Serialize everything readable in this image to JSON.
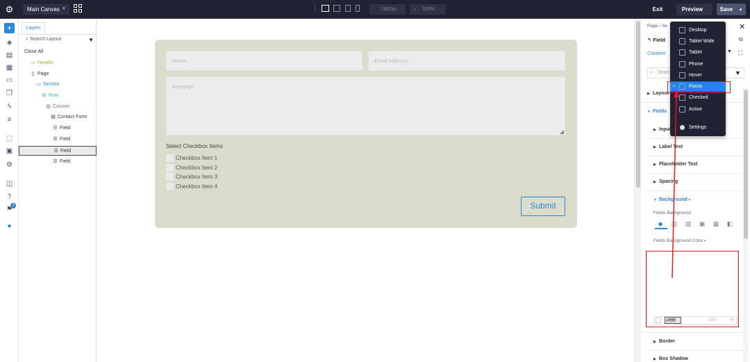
{
  "topbar": {
    "canvas_select": "Main Canvas",
    "width_value": "1382px",
    "zoom_value": "100%",
    "exit_label": "Exit",
    "preview_label": "Preview",
    "save_label": "Save"
  },
  "layers": {
    "tab_label": "Layers",
    "search_placeholder": "Search Layout",
    "close_all": "Close All",
    "tree": [
      {
        "label": "Header",
        "color": "#9cbc2c",
        "icon": "header-icon"
      },
      {
        "label": "Page",
        "color": "#333333",
        "icon": "page-icon"
      },
      {
        "label": "Section",
        "color": "#2b87da",
        "icon": "section-icon"
      },
      {
        "label": "Row",
        "color": "#29c4a9",
        "icon": "row-icon"
      },
      {
        "label": "Column",
        "color": "#777777",
        "icon": "column-icon"
      },
      {
        "label": "Contact Form",
        "color": "#333333",
        "icon": "module-icon"
      },
      {
        "label": "Field",
        "color": "#333333",
        "icon": "field-icon"
      },
      {
        "label": "Field",
        "color": "#333333",
        "icon": "field-icon"
      },
      {
        "label": "Field",
        "color": "#333333",
        "icon": "field-icon"
      },
      {
        "label": "Field",
        "color": "#333333",
        "icon": "field-icon"
      }
    ]
  },
  "form": {
    "name_placeholder": "Name",
    "email_placeholder": "Email Address",
    "message_placeholder": "Message",
    "checkbox_title": "Select Checkbox Items",
    "checkbox_items": [
      "Checkbox Item 1",
      "Checkbox Item 2",
      "Checkbox Item 3",
      "Checkbox Item 4"
    ],
    "submit_label": "Submit"
  },
  "settings": {
    "breadcrumb": "Page  ›  Se",
    "title": "Field",
    "tab_content": "Content",
    "search_placeholder": "Search",
    "groups": {
      "layout": "Layout",
      "fields": "Fields",
      "input": "Input",
      "label_text": "Label Text",
      "placeholder_text": "Placeholder Text",
      "spacing": "Spacing",
      "background": "Background",
      "border": "Border",
      "box_shadow": "Box Shadow"
    },
    "fields_background": "Fields Background",
    "fields_background_color": "Fields Background Color",
    "hex_value": "#ffffff",
    "opacity_value": "100",
    "opacity_unit": "%"
  },
  "state_menu": {
    "items": [
      {
        "label": "Desktop",
        "icon": "desktop-icon"
      },
      {
        "label": "Tablet Wide",
        "icon": "tablet-wide-icon"
      },
      {
        "label": "Tablet",
        "icon": "tablet-icon"
      },
      {
        "label": "Phone",
        "icon": "phone-icon"
      },
      {
        "label": "Hover",
        "icon": "cursor-icon"
      },
      {
        "label": "Focus",
        "icon": "focus-icon",
        "active": true
      },
      {
        "label": "Checked",
        "icon": "checked-icon"
      },
      {
        "label": "Active",
        "icon": "active-icon"
      },
      {
        "label": "Settings",
        "icon": "gear-icon"
      }
    ]
  },
  "colors": {
    "topbar": "#1f2333",
    "accent": "#2b87da",
    "form_bg": "#dcdccc",
    "annotation": "#e31b23",
    "menu_active": "#2b7fff"
  }
}
